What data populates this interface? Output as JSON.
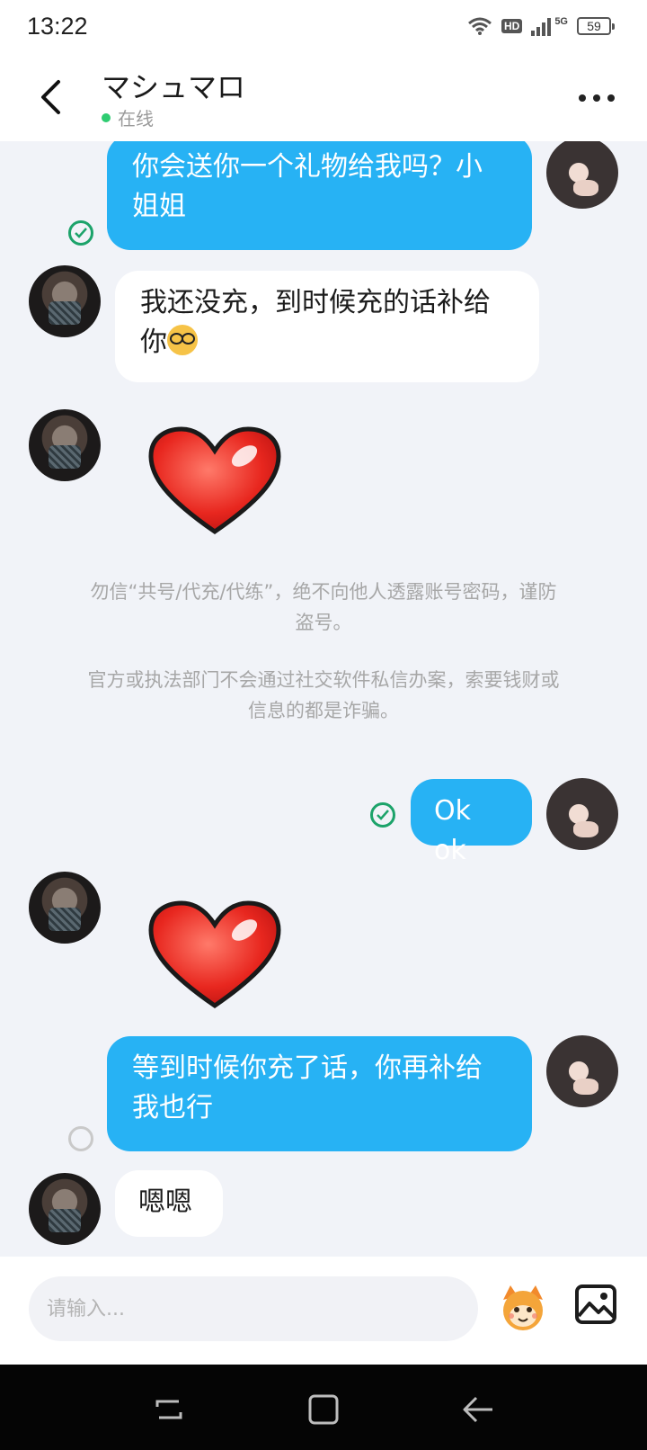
{
  "status_bar": {
    "time": "13:22",
    "hd": "HD",
    "network": "5G",
    "battery": "59"
  },
  "header": {
    "title": "マシュマロ",
    "status": "在线",
    "status_color": "#2ecc71"
  },
  "messages": [
    {
      "side": "out",
      "type": "text",
      "lines": [
        "你会送你一个礼物给我吗？小",
        "姐姐"
      ],
      "state": "read"
    },
    {
      "side": "in",
      "type": "text",
      "lines": [
        "我还没充，到时候充的话补给",
        "你"
      ],
      "emoji": "nerd-face"
    },
    {
      "side": "in",
      "type": "sticker",
      "sticker": "red-heart"
    },
    {
      "side": "out",
      "type": "text",
      "lines": [
        "Ok ok"
      ],
      "state": "read"
    },
    {
      "side": "in",
      "type": "sticker",
      "sticker": "red-heart"
    },
    {
      "side": "out",
      "type": "text",
      "lines": [
        "等到时候你充了话，你再补给",
        "我也行"
      ],
      "state": "sending"
    },
    {
      "side": "in",
      "type": "text",
      "lines": [
        "嗯嗯"
      ]
    }
  ],
  "notices": {
    "notice_1": [
      "勿信“共号/代充/代练”，绝不向他人透露账号密码，谨防",
      "盗号。"
    ],
    "notice_2": [
      "官方或执法部门不会通过社交软件私信办案，索要钱财或",
      "信息的都是诈骗。"
    ]
  },
  "input": {
    "placeholder": "请输入..."
  },
  "colors": {
    "outgoing_bubble": "#27b2f4",
    "incoming_bubble": "#ffffff",
    "read_check": "#1ca36a",
    "background": "#f1f3f8"
  },
  "icons": {
    "back": "chevron-left-icon",
    "more": "more-dots-icon",
    "sticker": "mascot-icon",
    "image": "image-icon",
    "nav_recent": "recent-apps-icon",
    "nav_home": "home-icon",
    "nav_back": "back-arrow-icon"
  }
}
